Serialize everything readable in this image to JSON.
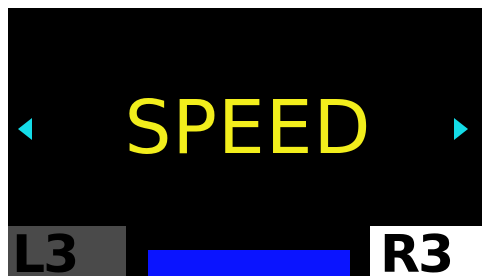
{
  "screen": {
    "value_text": "SPEED"
  },
  "buttons": {
    "left_label": "L3",
    "right_label": "R3"
  },
  "colors": {
    "background": "#000000",
    "text": "#f2ee1c",
    "arrows": "#14dce8",
    "bar": "#0a14ff",
    "left_button_bg": "#4a4a4a",
    "right_button_bg": "#ffffff"
  },
  "icons": {
    "left": "triangle-left-icon",
    "right": "triangle-right-icon"
  }
}
